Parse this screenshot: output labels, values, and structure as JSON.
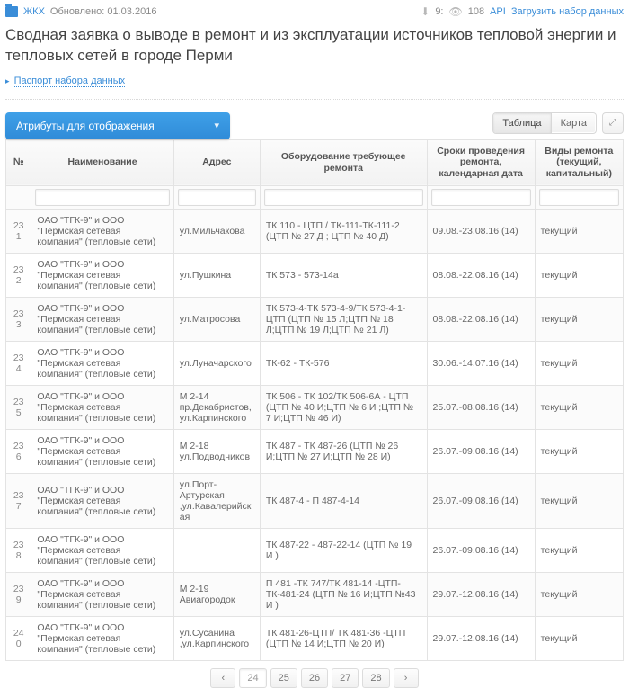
{
  "meta": {
    "category": "ЖКХ",
    "updated_label": "Обновлено: 01.03.2016",
    "downloads": "9:",
    "views": "108",
    "api_label": "API",
    "download_dataset": "Загрузить набор данных"
  },
  "title": "Сводная заявка о выводе в ремонт и из эксплуатации источников тепловой энергии и тепловых сетей в городе Перми",
  "passport_link": "Паспорт набора данных",
  "attributes_bar": "Атрибуты для отображения",
  "view": {
    "table": "Таблица",
    "map": "Карта"
  },
  "table": {
    "headers": {
      "num": "№",
      "name": "Наименование",
      "address": "Адрес",
      "equip": "Оборудование требующее ремонта",
      "dates": "Сроки проведения ремонта, календарная дата",
      "type": "Виды ремонта (текущий, капитальный)"
    },
    "rows": [
      {
        "num": "231",
        "name": "ОАО \"ТГК-9\" и ООО \"Пермская сетевая компания\" (тепловые сети)",
        "addr": "ул.Мильчакова",
        "equip": "ТК 110 - ЦТП / ТК-111-ТК-111-2 (ЦТП № 27 Д ; ЦТП № 40 Д)",
        "dates": "09.08.-23.08.16 (14)",
        "type": "текущий"
      },
      {
        "num": "232",
        "name": "ОАО \"ТГК-9\" и ООО \"Пермская сетевая компания\" (тепловые сети)",
        "addr": "ул.Пушкина",
        "equip": "ТК 573 - 573-14а",
        "dates": "08.08.-22.08.16 (14)",
        "type": "текущий"
      },
      {
        "num": "233",
        "name": "ОАО \"ТГК-9\" и ООО \"Пермская сетевая компания\" (тепловые сети)",
        "addr": "ул.Матросова",
        "equip": "ТК 573-4-ТК 573-4-9/ТК 573-4-1- ЦТП (ЦТП № 15 Л;ЦТП № 18 Л;ЦТП № 19 Л;ЦТП № 21 Л)",
        "dates": "08.08.-22.08.16 (14)",
        "type": "текущий"
      },
      {
        "num": "234",
        "name": "ОАО \"ТГК-9\" и ООО \"Пермская сетевая компания\" (тепловые сети)",
        "addr": "ул.Луначарского",
        "equip": "ТК-62 - ТК-576",
        "dates": "30.06.-14.07.16 (14)",
        "type": "текущий"
      },
      {
        "num": "235",
        "name": "ОАО \"ТГК-9\" и ООО \"Пермская сетевая компания\" (тепловые сети)",
        "addr": "М 2-14 пр.Декабристов, ул.Карпинского",
        "equip": "ТК 506 - ТК 102/ТК 506-6А - ЦТП (ЦТП № 40 И;ЦТП № 6 И ;ЦТП № 7 И;ЦТП № 46 И)",
        "dates": "25.07.-08.08.16 (14)",
        "type": "текущий"
      },
      {
        "num": "236",
        "name": "ОАО \"ТГК-9\" и ООО \"Пермская сетевая компания\" (тепловые сети)",
        "addr": "М 2-18 ул.Подводников",
        "equip": "ТК 487 - ТК 487-26 (ЦТП № 26 И;ЦТП № 27 И;ЦТП № 28 И)",
        "dates": "26.07.-09.08.16 (14)",
        "type": "текущий"
      },
      {
        "num": "237",
        "name": "ОАО \"ТГК-9\" и ООО \"Пермская сетевая компания\" (тепловые сети)",
        "addr": "ул.Порт-Артурская ,ул.Кавалерийская",
        "equip": "ТК 487-4 - П 487-4-14",
        "dates": "26.07.-09.08.16 (14)",
        "type": "текущий"
      },
      {
        "num": "238",
        "name": "ОАО \"ТГК-9\" и ООО \"Пермская сетевая компания\" (тепловые сети)",
        "addr": "",
        "equip": "ТК 487-22 - 487-22-14 (ЦТП № 19 И )",
        "dates": "26.07.-09.08.16 (14)",
        "type": "текущий"
      },
      {
        "num": "239",
        "name": "ОАО \"ТГК-9\" и ООО \"Пермская сетевая компания\" (тепловые сети)",
        "addr": "М 2-19 Авиагородок",
        "equip": "П 481 -ТК 747/ТК 481-14 -ЦТП-ТК-481-24 (ЦТП № 16 И;ЦТП №43 И )",
        "dates": "29.07.-12.08.16 (14)",
        "type": "текущий"
      },
      {
        "num": "240",
        "name": "ОАО \"ТГК-9\" и ООО \"Пермская сетевая компания\" (тепловые сети)",
        "addr": "ул.Сусанина ,ул.Карпинского",
        "equip": "ТК 481-26-ЦТП/ ТК 481-36 -ЦТП (ЦТП № 14 И;ЦТП № 20 И)",
        "dates": "29.07.-12.08.16 (14)",
        "type": "текущий"
      }
    ]
  },
  "pager": {
    "pages": [
      "24",
      "25",
      "26",
      "27",
      "28"
    ],
    "current": "24"
  }
}
